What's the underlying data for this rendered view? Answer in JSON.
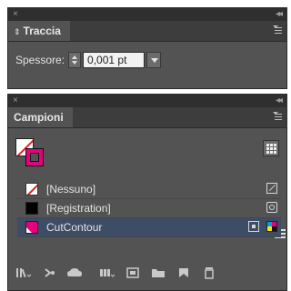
{
  "traccia_panel": {
    "title": "Traccia",
    "weight_label": "Spessore:",
    "weight_value": "0,001 pt"
  },
  "campioni_panel": {
    "title": "Campioni",
    "swatches": [
      {
        "name": "[Nessuno]"
      },
      {
        "name": "[Registration]"
      },
      {
        "name": "CutContour"
      }
    ]
  },
  "glyphs": {
    "close": "×",
    "collapse": "◂◂",
    "updown": "⇕"
  },
  "colors": {
    "panel_bg": "#535353",
    "selected_row": "#3d4d66",
    "cutcontour": "#e5007e",
    "none_slash": "#e0202a"
  }
}
